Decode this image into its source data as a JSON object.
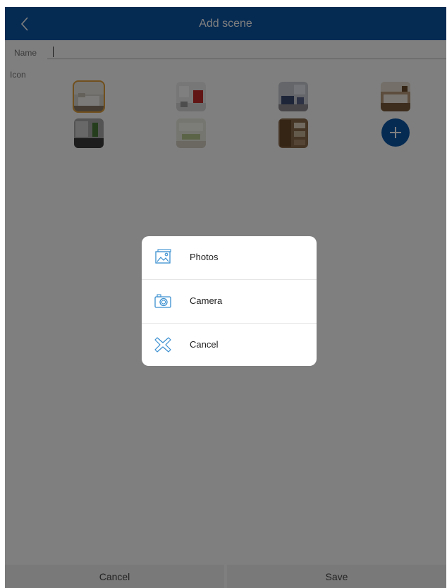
{
  "header": {
    "title": "Add scene",
    "back_icon": "chevron-left-icon"
  },
  "form": {
    "name_label": "Name",
    "name_value": "",
    "icon_label": "Icon"
  },
  "icons": [
    {
      "name": "bedroom-white"
    },
    {
      "name": "kitchen-red"
    },
    {
      "name": "living-room-blue"
    },
    {
      "name": "bedroom-wood"
    },
    {
      "name": "bathroom-gray"
    },
    {
      "name": "dining-light"
    },
    {
      "name": "study-wood"
    }
  ],
  "add_icon": "plus-icon",
  "dialog": {
    "items": [
      {
        "label": "Photos",
        "icon": "photos-icon"
      },
      {
        "label": "Camera",
        "icon": "camera-icon"
      },
      {
        "label": "Cancel",
        "icon": "cancel-x-icon"
      }
    ]
  },
  "footer": {
    "cancel_label": "Cancel",
    "save_label": "Save"
  },
  "colors": {
    "primary": "#0c57a6",
    "overlay": "rgba(0,0,0,0.5)",
    "selected_outline": "#e2a13b",
    "dialog_icon": "#3a8fd0"
  }
}
